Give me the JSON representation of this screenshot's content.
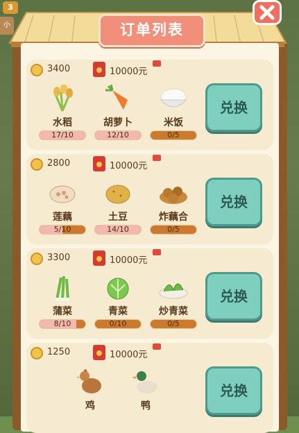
{
  "hud": {
    "level": "3",
    "side_label": "小"
  },
  "title": "订单列表",
  "exchange_label": "兑换",
  "orders": [
    {
      "coins": "3400",
      "cash": "10000元",
      "items": [
        {
          "name": "水稻",
          "progress": "17/10",
          "fill": 1.0
        },
        {
          "name": "胡萝卜",
          "progress": "12/10",
          "fill": 1.0
        },
        {
          "name": "米饭",
          "progress": "0/5",
          "fill": 0.0
        }
      ]
    },
    {
      "coins": "2800",
      "cash": "10000元",
      "items": [
        {
          "name": "莲藕",
          "progress": "5/10",
          "fill": 0.5
        },
        {
          "name": "土豆",
          "progress": "14/10",
          "fill": 1.0
        },
        {
          "name": "炸藕合",
          "progress": "0/5",
          "fill": 0.0
        }
      ]
    },
    {
      "coins": "3300",
      "cash": "10000元",
      "items": [
        {
          "name": "蒲菜",
          "progress": "8/10",
          "fill": 0.8
        },
        {
          "name": "青菜",
          "progress": "0/10",
          "fill": 0.0
        },
        {
          "name": "炒青菜",
          "progress": "0/5",
          "fill": 0.0
        }
      ]
    },
    {
      "coins": "1250",
      "cash": "10000元",
      "items": [
        {
          "name": "鸡"
        },
        {
          "name": "鸭"
        }
      ]
    }
  ],
  "colors": {
    "title": "#f28f7b",
    "exchange": "#7fcfbf",
    "close": "#f26f5f",
    "board": "#8b5a2b",
    "bar_fill": "#f4b8b1",
    "bar_empty": "#cc7a2e"
  }
}
